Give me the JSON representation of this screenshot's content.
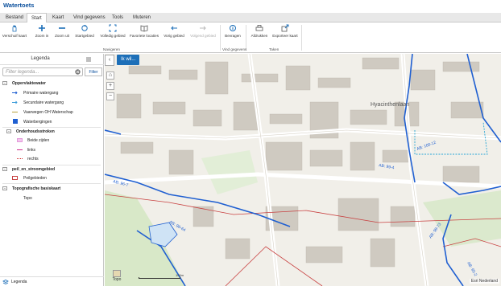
{
  "app": {
    "title": "Watertoets"
  },
  "tabs": [
    {
      "label": "Bestand",
      "active": false
    },
    {
      "label": "Start",
      "active": true
    },
    {
      "label": "Kaart",
      "active": false
    },
    {
      "label": "Vind gegevens",
      "active": false
    },
    {
      "label": "Tools",
      "active": false
    },
    {
      "label": "Muteren",
      "active": false
    }
  ],
  "ribbon": {
    "buttons": [
      {
        "label": "Verschuif kaart",
        "icon": "hand-icon",
        "disabled": false
      },
      {
        "label": "Zoom in",
        "icon": "zoom-in-icon",
        "disabled": false
      },
      {
        "label": "Zoom uit",
        "icon": "zoom-out-icon",
        "disabled": false
      },
      {
        "label": "Startgebied",
        "icon": "home-icon",
        "disabled": false
      },
      {
        "label": "Volledig gebied",
        "icon": "full-extent-icon",
        "disabled": false
      },
      {
        "label": "Favoriete locaties",
        "icon": "book-icon",
        "disabled": false
      },
      {
        "label": "Vorig gebied",
        "icon": "back-arrow-icon",
        "disabled": false
      },
      {
        "label": "Volgend gebied",
        "icon": "forward-arrow-icon",
        "disabled": true
      },
      {
        "label": "Bevragen",
        "icon": "identify-icon",
        "disabled": false
      },
      {
        "label": "Afdrukken",
        "icon": "print-icon",
        "disabled": false
      },
      {
        "label": "Exporteer kaart",
        "icon": "export-map-icon",
        "disabled": false
      }
    ],
    "groups": {
      "navigeren": "Navigeren",
      "vind": "Vind gegevens",
      "taken": "Taken"
    }
  },
  "legend": {
    "title": "Legenda",
    "filter_placeholder": "Filter legenda...",
    "filter_button": "Filter",
    "groups": [
      {
        "label": "Oppervlaktewater",
        "items": [
          "Primaire watergang",
          "Secundaire watergang",
          "Vaarwegen OH Waterschap",
          "Waterbergingen"
        ]
      },
      {
        "label": "Onderhoudsstroken",
        "items": [
          "Beide zijden",
          "links",
          "rechts"
        ]
      },
      {
        "label": "peil_en_stroomgebied",
        "items": [
          "Peilgebieden"
        ]
      },
      {
        "label": "Topografische basiskaart",
        "items": [
          "Topo"
        ]
      }
    ],
    "footer": "Legenda"
  },
  "map": {
    "ik_wil": "Ik wil...",
    "basemap_label": "Topo",
    "scale_label": "100m",
    "attribution": "Esri Nederland",
    "labels": [
      "Hyacinthenlaan",
      "AB: 100-12",
      "AB: 99-4",
      "AB: 96-7",
      "AB: 96-64",
      "AB: 99-73",
      "AB: 95-2"
    ],
    "colors": {
      "primary": "#1f5fd1",
      "secondary": "#3a9bd9",
      "cyan_dash": "#29a6d6",
      "peil": "#c84040",
      "ik_wil_bg": "#1d6fb8"
    }
  }
}
